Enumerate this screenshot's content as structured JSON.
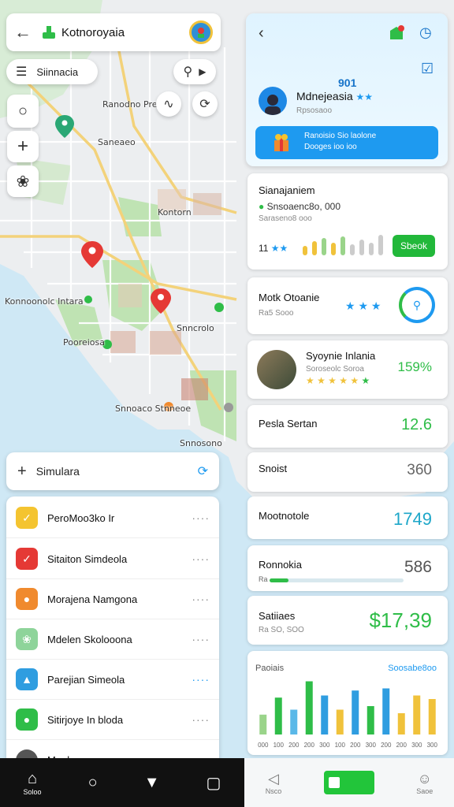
{
  "header": {
    "title": "Kotnoroyaia",
    "back_icon": "back-arrow-icon"
  },
  "menu": {
    "label": "Siinnacia"
  },
  "map": {
    "labels": [
      "Ranodno Prees",
      "Konnoonolc Intara",
      "Pooreiosa",
      "Snncrolo",
      "Saneaeo",
      "Kontorn",
      "Snnoaco Stnneoe",
      "Snnosono"
    ]
  },
  "right_panel": {
    "code": "901",
    "profile_name": "Mdnejeasia",
    "profile_sub": "Rpsosaoo",
    "banner_line1": "Ranoisio Sio laolone",
    "banner_line2": "Dooges ioo ioo",
    "accent": "#1e9af0"
  },
  "stats": [
    {
      "label": "Sianajaniem",
      "sub": "Snsoaenc8o, 000",
      "sub2": "Saraseno8 ooo",
      "button": "Sbeok"
    },
    {
      "label": "Motk Otoanie",
      "sub": "Ra5 Sooo"
    },
    {
      "label": "Syoynie Inlania",
      "sub": "Soroseolc Soroa",
      "value": "159%"
    },
    {
      "label": "Pesla Sertan",
      "value": "12.6"
    },
    {
      "label": "Snoist",
      "value": "360"
    },
    {
      "label": "Mootnotole",
      "value": "1749"
    },
    {
      "label": "Ronnokia",
      "value": "586",
      "progress": 0.14
    },
    {
      "label": "Satiiaes",
      "sub": "Ra SO, SOO",
      "value": "$17,39"
    }
  ],
  "chart_data": {
    "type": "bar",
    "title": "Paoiais",
    "legend_label": "Soosabe8oo",
    "categories": [
      "000",
      "100",
      "200",
      "200",
      "300",
      "100",
      "200",
      "300",
      "200",
      "200",
      "300",
      "300"
    ],
    "values": [
      28,
      52,
      35,
      75,
      55,
      35,
      62,
      40,
      65,
      30,
      55,
      50
    ],
    "colors": [
      "#9ad48a",
      "#2fbd48",
      "#5ab8e8",
      "#2fbd48",
      "#2f9de0",
      "#f0c23b",
      "#2f9de0",
      "#2fbd48",
      "#2f9de0",
      "#f0c23b",
      "#f0c23b",
      "#f0c23b"
    ]
  },
  "list": {
    "header": "Simulara",
    "items": [
      {
        "label": "PeroMoo3ko Ir",
        "color": "#f4c430",
        "icon": "check-icon"
      },
      {
        "label": "Sitaiton Simdeola",
        "color": "#e53935",
        "icon": "check-icon"
      },
      {
        "label": "Morajena Namgona",
        "color": "#f08a2e",
        "icon": "car-icon"
      },
      {
        "label": "Mdelen Skolooona",
        "color": "#8ed49a",
        "icon": "leaf-icon"
      },
      {
        "label": "Parejian Simeola",
        "color": "#2f9de0",
        "icon": "thumb-icon"
      },
      {
        "label": "Sitirjoye In bloda",
        "color": "#2fbd48",
        "icon": "person-icon"
      },
      {
        "label": "Menlenosa",
        "color": "#555555",
        "icon": "circle-icon"
      }
    ]
  },
  "nav": {
    "home_label": "Soloo",
    "rnav_left": "Nsco",
    "rnav_right": "Saoe"
  }
}
